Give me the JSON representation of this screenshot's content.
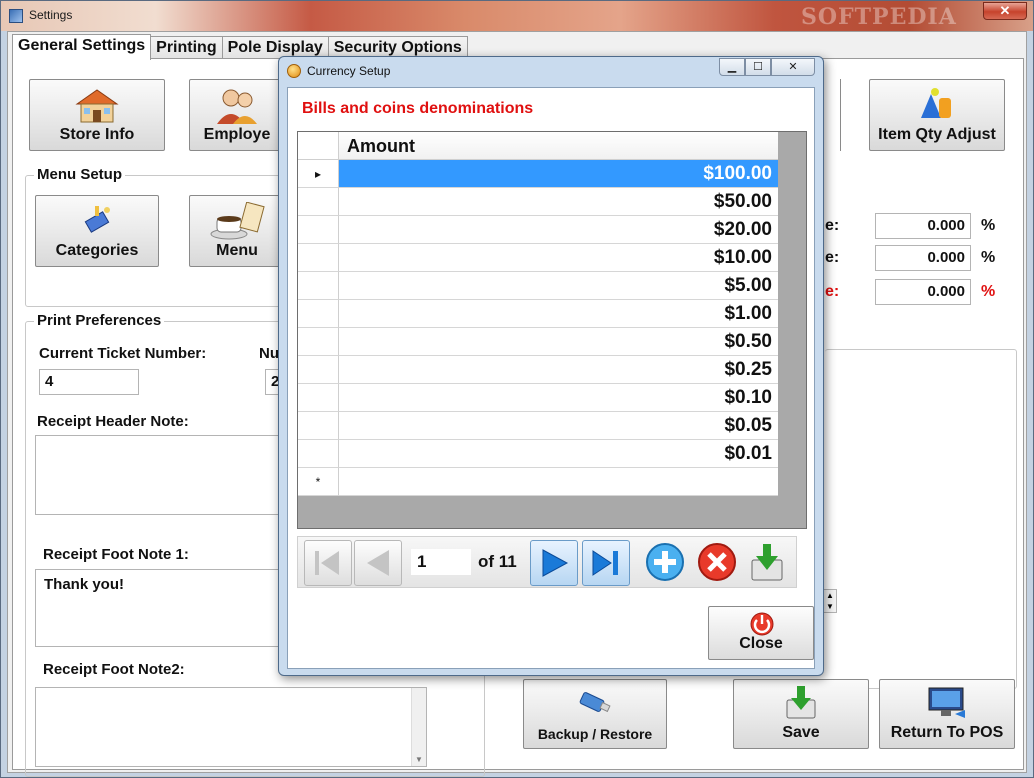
{
  "window": {
    "title": "Settings",
    "close_glyph": "✕",
    "watermark": "SOFTPEDIA"
  },
  "tabs": [
    {
      "label": "General Settings",
      "active": true
    },
    {
      "label": "Printing"
    },
    {
      "label": "Pole Display"
    },
    {
      "label": "Security Options"
    }
  ],
  "top_buttons": {
    "store_info": "Store Info",
    "employees": "Employe",
    "item_qty_adjust": "Item Qty Adjust"
  },
  "menu_setup": {
    "title": "Menu Setup",
    "categories": "Categories",
    "menu": "Menu"
  },
  "tax": {
    "rows": [
      {
        "label_tail": "e:",
        "value": "0.000",
        "unit": "%",
        "color": "#111111"
      },
      {
        "label_tail": "e:",
        "value": "0.000",
        "unit": "%",
        "color": "#111111"
      },
      {
        "label_tail": "e:",
        "value": "0.000",
        "unit": "%",
        "color": "#e01010"
      }
    ]
  },
  "print_prefs": {
    "title": "Print Preferences",
    "current_ticket_label": "Current Ticket Number:",
    "current_ticket_value": "4",
    "num_label_partial": "Nu",
    "num_value_partial": "2",
    "receipt_header_label": "Receipt Header Note:",
    "receipt_header_value": "",
    "foot_note1_label": "Receipt Foot Note 1:",
    "foot_note1_value": "Thank you!",
    "foot_note2_label": "Receipt Foot Note2:",
    "foot_note2_value": ""
  },
  "bottom_buttons": {
    "backup_restore": "Backup / Restore",
    "save": "Save",
    "return_to_pos": "Return To POS"
  },
  "dialog": {
    "title": "Currency Setup",
    "heading": "Bills and coins denominations",
    "column_header": "Amount",
    "rows": [
      "$100.00",
      "$50.00",
      "$20.00",
      "$10.00",
      "$5.00",
      "$1.00",
      "$0.50",
      "$0.25",
      "$0.10",
      "$0.05",
      "$0.01"
    ],
    "selected_index": 0,
    "current_row_marker": "▸",
    "new_row_marker": "*",
    "navigator": {
      "position": "1",
      "count_text": "of 11"
    },
    "close_label": "Close"
  },
  "colors": {
    "accent_red": "#e01010",
    "selection_blue": "#3399ff"
  }
}
